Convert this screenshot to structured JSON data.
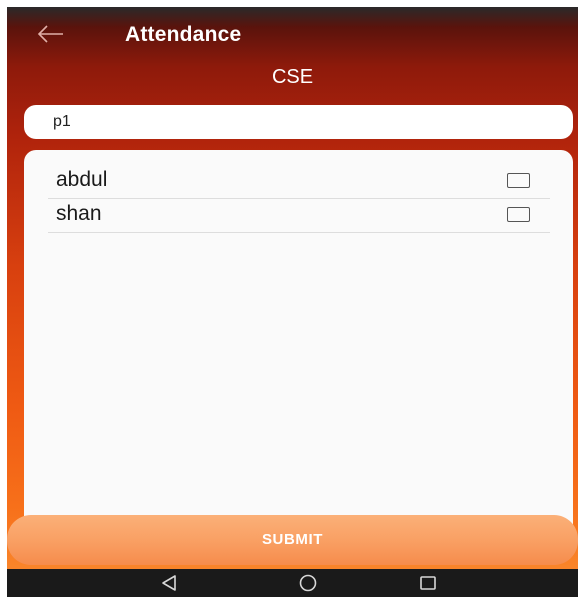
{
  "app_bar": {
    "title": "Attendance",
    "back_icon": "arrow-left-icon"
  },
  "department": "CSE",
  "period_field": {
    "value": "p1"
  },
  "students": [
    {
      "name": "abdul",
      "checked": false
    },
    {
      "name": "shan",
      "checked": false
    }
  ],
  "submit_label": "SUBMIT",
  "nav_bar": {
    "icons": [
      "back-triangle-icon",
      "home-circle-icon",
      "recents-square-icon"
    ]
  },
  "colors": {
    "header_dark": "#8e1a0b",
    "gradient_bottom": "#f98429",
    "button": "#f9a064",
    "nav_bar": "#1a1a1a"
  }
}
